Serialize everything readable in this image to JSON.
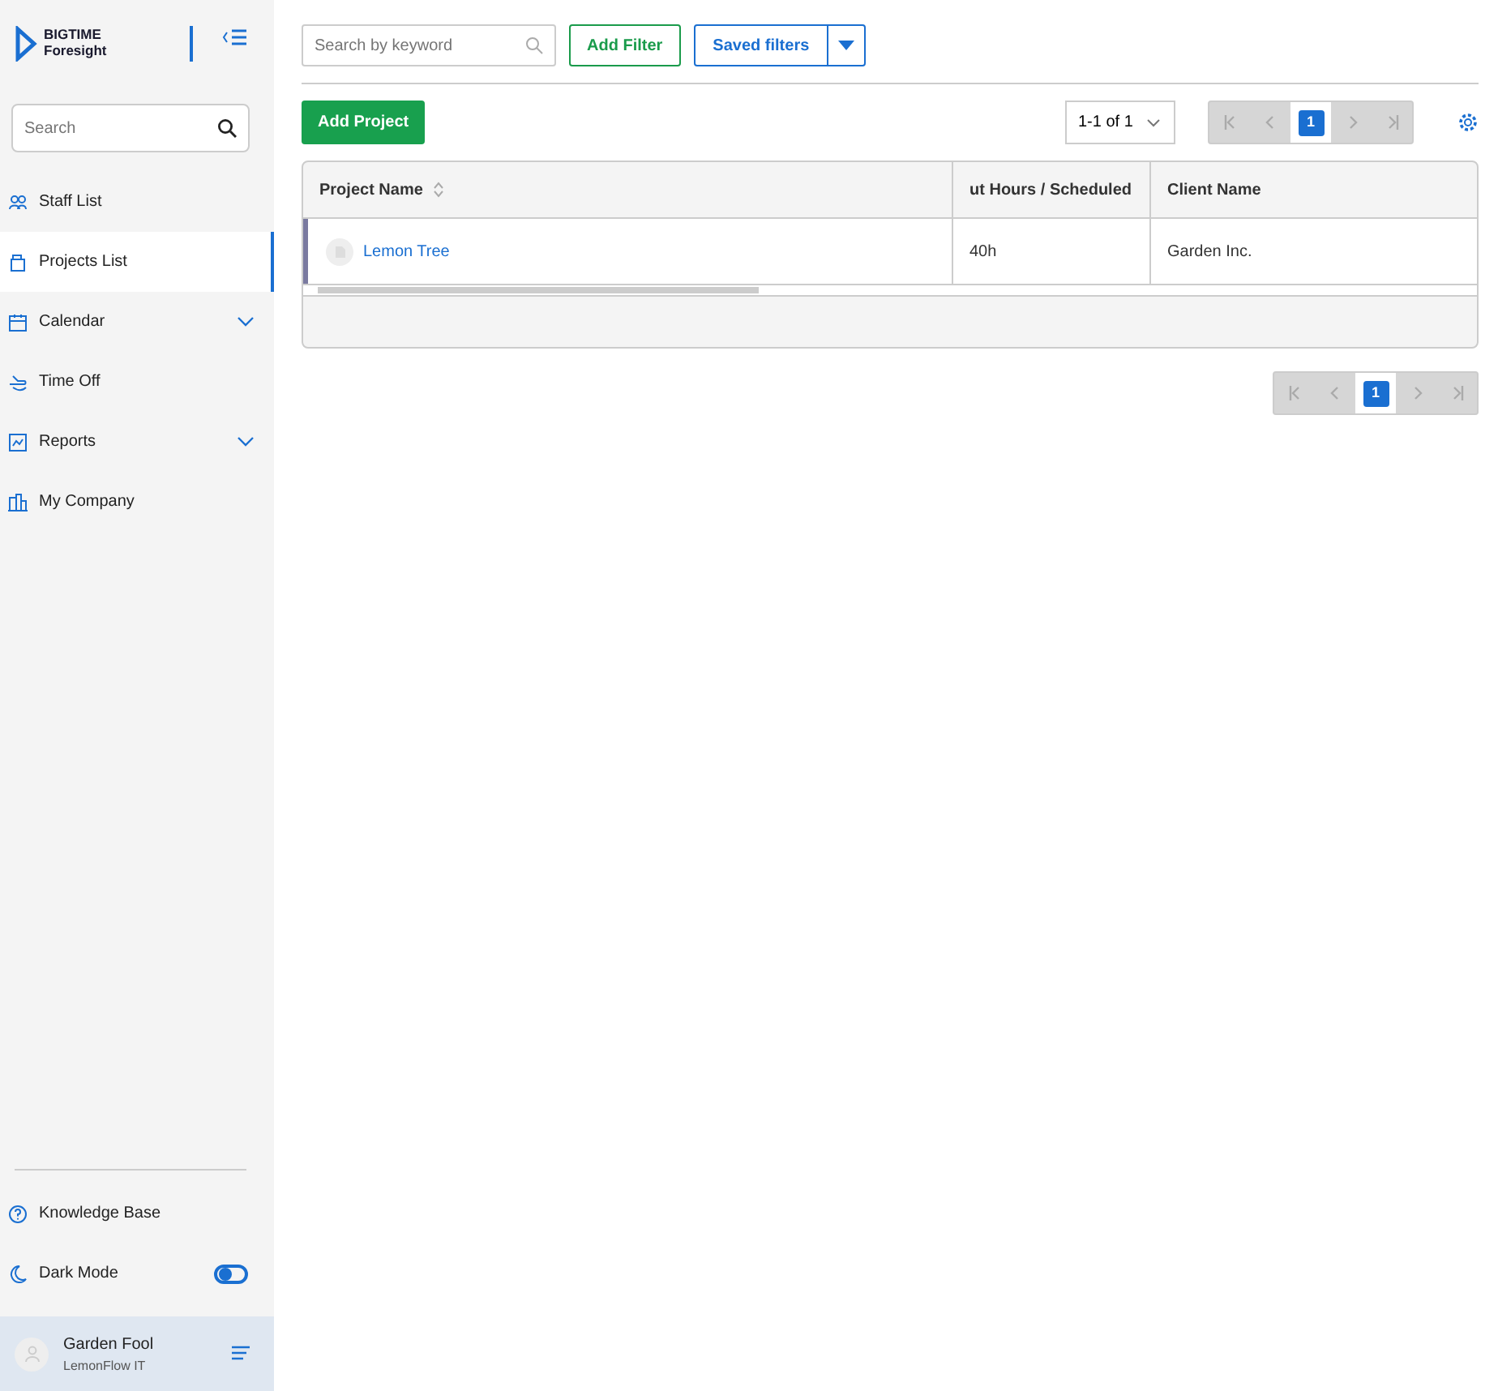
{
  "logo": {
    "line1": "BIGTIME",
    "line2": "Foresight"
  },
  "sidebar": {
    "search": {
      "placeholder": "Search"
    },
    "items": [
      {
        "label": "Staff List",
        "selected": false,
        "expandable": false
      },
      {
        "label": "Projects List",
        "selected": true,
        "expandable": false
      },
      {
        "label": "Calendar",
        "selected": false,
        "expandable": true
      },
      {
        "label": "Time Off",
        "selected": false,
        "expandable": false
      },
      {
        "label": "Reports",
        "selected": false,
        "expandable": true
      },
      {
        "label": "My Company",
        "selected": false,
        "expandable": false
      }
    ],
    "bottom_items": [
      {
        "label": "Knowledge Base",
        "kind": "link"
      },
      {
        "label": "Dark Mode",
        "kind": "toggle",
        "on": false
      }
    ],
    "user": {
      "name": "Garden Fool",
      "company": "LemonFlow IT"
    }
  },
  "toolbar": {
    "search": {
      "placeholder": "Search by keyword"
    },
    "add_filter": "Add Filter",
    "saved_filters": "Saved filters",
    "add_project": "Add Project",
    "range": "1-1 of 1"
  },
  "pagination_top": {
    "pages": [
      {
        "label": "1",
        "selected": true
      }
    ]
  },
  "table": {
    "columns": [
      {
        "label": "Project Name",
        "sortable": true
      },
      {
        "label": "ut Hours / Scheduled",
        "sortable": false
      },
      {
        "label": "Client Name",
        "sortable": false
      }
    ],
    "rows": [
      {
        "cells": [
          "Lemon Tree",
          "40h",
          "Garden Inc."
        ]
      }
    ]
  },
  "pagination_bottom": {
    "pages": [
      {
        "label": "1",
        "selected": true
      }
    ]
  }
}
